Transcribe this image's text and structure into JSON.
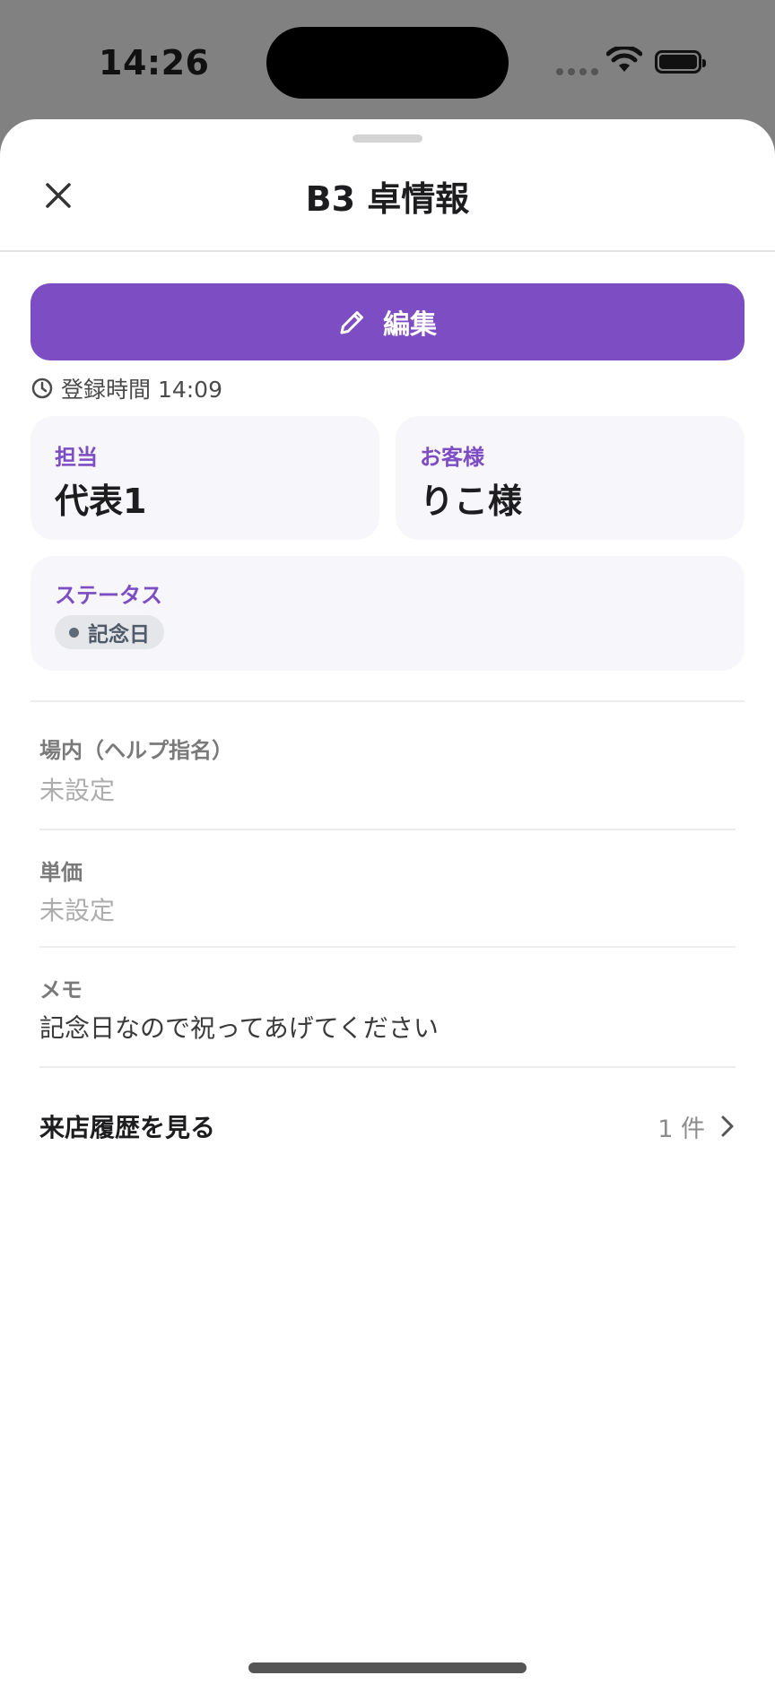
{
  "status_bar": {
    "time": "14:26"
  },
  "sheet": {
    "title": "B3 卓情報",
    "close_icon": "close-icon",
    "edit_label": "編集",
    "registered_time": "登録時間 14:09"
  },
  "cards": {
    "staff": {
      "label": "担当",
      "value": "代表1"
    },
    "customer": {
      "label": "お客様",
      "value": "りこ様"
    },
    "status": {
      "label": "ステータス",
      "badge": "記念日"
    }
  },
  "fields": {
    "help": {
      "label": "場内（ヘルプ指名）",
      "value": "未設定"
    },
    "price": {
      "label": "単価",
      "value": "未設定"
    },
    "memo": {
      "label": "メモ",
      "value": "記念日なので祝ってあげてください"
    }
  },
  "history": {
    "label": "来店履歴を見る",
    "count": "1 件"
  },
  "colors": {
    "accent": "#7c4dc3",
    "card_bg": "#f7f6fb"
  }
}
